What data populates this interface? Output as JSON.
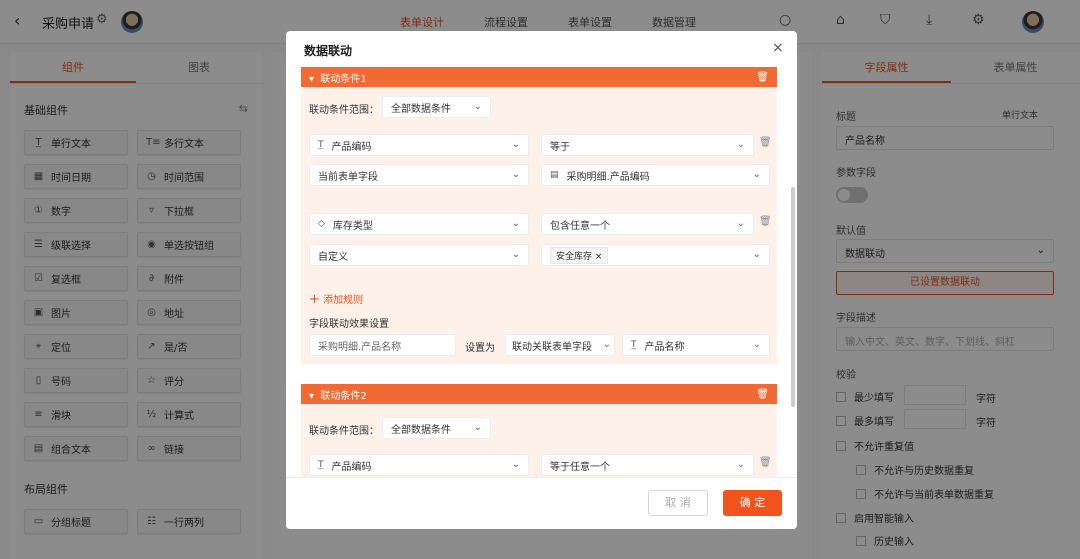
{
  "app": {
    "title": "采购申请"
  },
  "top_tabs": [
    {
      "label": "表单设计"
    },
    {
      "label": "流程设置"
    },
    {
      "label": "表单设置"
    },
    {
      "label": "数据管理"
    }
  ],
  "left": {
    "tabs": [
      {
        "label": "组件"
      },
      {
        "label": "图表"
      }
    ],
    "basic_title": "基础组件",
    "layout_title": "布局组件",
    "basic": [
      {
        "label": "单行文本",
        "icon": "text-line-icon"
      },
      {
        "label": "多行文本",
        "icon": "text-multi-icon"
      },
      {
        "label": "时间日期",
        "icon": "calendar-icon"
      },
      {
        "label": "时间范围",
        "icon": "clock-icon"
      },
      {
        "label": "数字",
        "icon": "number-icon"
      },
      {
        "label": "下拉框",
        "icon": "dropdown-icon"
      },
      {
        "label": "级联选择",
        "icon": "cascade-icon"
      },
      {
        "label": "单选按钮组",
        "icon": "radio-icon"
      },
      {
        "label": "复选框",
        "icon": "checkbox-icon"
      },
      {
        "label": "附件",
        "icon": "paperclip-icon"
      },
      {
        "label": "图片",
        "icon": "image-icon"
      },
      {
        "label": "地址",
        "icon": "location-icon"
      },
      {
        "label": "定位",
        "icon": "locate-icon"
      },
      {
        "label": "是/否",
        "icon": "toggle-icon"
      },
      {
        "label": "号码",
        "icon": "phone-icon"
      },
      {
        "label": "评分",
        "icon": "star-icon"
      },
      {
        "label": "滑块",
        "icon": "slider-icon"
      },
      {
        "label": "计算式",
        "icon": "formula-icon"
      },
      {
        "label": "组合文本",
        "icon": "combo-text-icon"
      },
      {
        "label": "链接",
        "icon": "link-icon"
      }
    ],
    "layout": [
      {
        "label": "分组标题",
        "icon": "group-title-icon"
      },
      {
        "label": "一行两列",
        "icon": "two-column-icon"
      }
    ]
  },
  "right": {
    "tabs": [
      {
        "label": "字段属性"
      },
      {
        "label": "表单属性"
      }
    ],
    "title_label": "标题",
    "title_type": "单行文本",
    "title_value": "产品名称",
    "param_label": "参数字段",
    "default_label": "默认值",
    "default_value": "数据联动",
    "linkage_button": "已设置数据联动",
    "desc_label": "字段描述",
    "desc_placeholder": "输入中文、英文、数字、下划线、斜杠",
    "validate_label": "校验",
    "min_label": "最少填写",
    "min_unit": "字符",
    "max_label": "最多填写",
    "max_unit": "字符",
    "no_dup": "不允许重复值",
    "no_dup_history": "不允许与历史数据重复",
    "no_dup_current": "不允许与当前表单数据重复",
    "smart_input": "启用智能输入",
    "history_input": "历史输入"
  },
  "modal": {
    "title": "数据联动",
    "cond1": {
      "title": "联动条件1",
      "scope_label": "联动条件范围：",
      "scope_value": "全部数据条件",
      "r1_field": "产品编码",
      "r1_op": "等于",
      "r1_src": "当前表单字段",
      "r1_target": "采购明细.产品编码",
      "r2_field": "库存类型",
      "r2_op": "包含任意一个",
      "r2_src": "自定义",
      "r2_tag": "安全库存",
      "add_rule": "添加规则",
      "effect_label": "字段联动效果设置",
      "effect_field": "采购明细.产品名称",
      "set_as": "设置为",
      "effect_mode": "联动关联表单字段",
      "effect_target": "产品名称"
    },
    "cond2": {
      "title": "联动条件2",
      "scope_label": "联动条件范围：",
      "scope_value": "全部数据条件",
      "r1_field": "产品编码",
      "r1_op": "等于任意一个"
    },
    "cancel": "取 消",
    "ok": "确 定"
  },
  "colors": {
    "accent": "#e8541e",
    "cond_header": "#f26a33"
  }
}
